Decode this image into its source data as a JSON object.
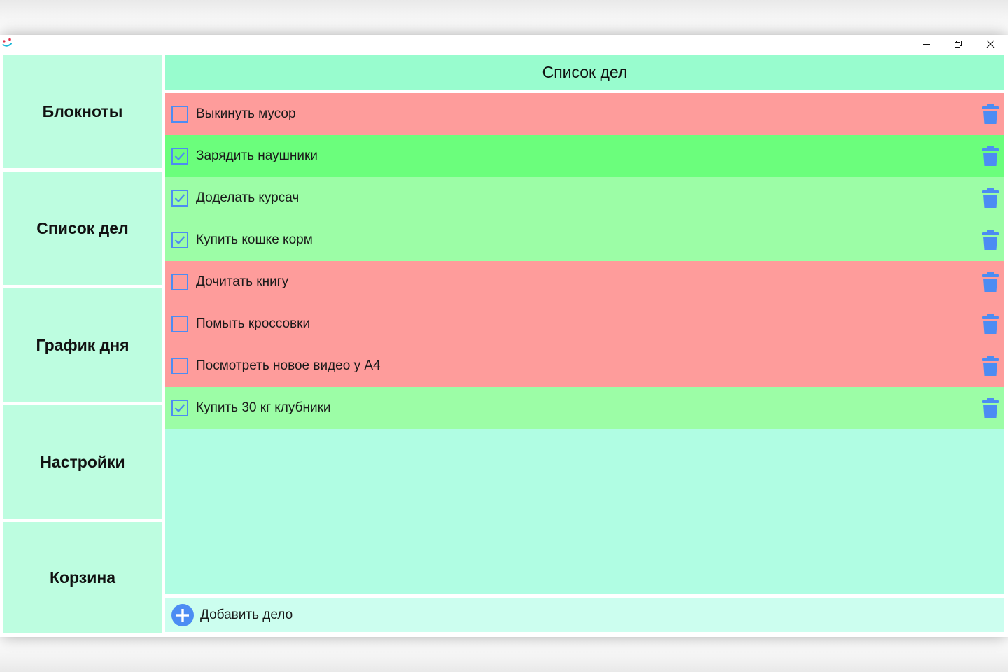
{
  "window": {
    "app_icon": "app-logo-icon",
    "controls": [
      "minimize-icon",
      "restore-icon",
      "close-icon"
    ]
  },
  "sidebar": {
    "items": [
      {
        "label": "Блокноты"
      },
      {
        "label": "Список дел"
      },
      {
        "label": "График дня"
      },
      {
        "label": "Настройки"
      },
      {
        "label": "Корзина"
      }
    ]
  },
  "main": {
    "title": "Список дел",
    "tasks": [
      {
        "label": "Выкинуть мусор",
        "done": false
      },
      {
        "label": "Зарядить наушники",
        "done": true
      },
      {
        "label": "Доделать курсач",
        "done": true
      },
      {
        "label": "Купить кошке корм",
        "done": true
      },
      {
        "label": "Дочитать книгу",
        "done": false
      },
      {
        "label": "Помыть кроссовки",
        "done": false
      },
      {
        "label": "Посмотреть новое видео у А4",
        "done": false
      },
      {
        "label": "Купить 30 кг клубники",
        "done": true
      }
    ],
    "add_label": "Добавить дело"
  },
  "colors": {
    "sidebar_bg": "#bdfde0",
    "header_bg": "#98fcce",
    "list_bg": "#b0fde3",
    "task_undone": "#fe9c9b",
    "task_done": "#9cfda6",
    "task_done_hover": "#6bfe7c",
    "accent_blue": "#4c8cf3",
    "add_bar_bg": "#ccfeef"
  }
}
